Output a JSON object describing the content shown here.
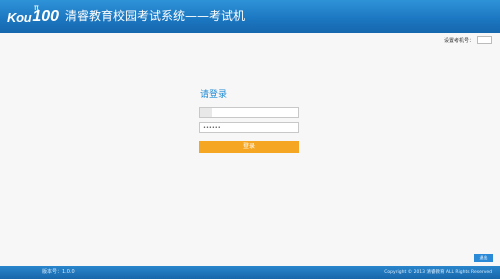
{
  "header": {
    "logo_text": "Kou",
    "logo_number": "100",
    "logo_mark": "π",
    "title": "清睿教育校园考试系统——考试机"
  },
  "machine": {
    "label": "设置考机号："
  },
  "login": {
    "title": "请登录",
    "username_value": "",
    "password_value": "••••••",
    "button_label": "登录"
  },
  "exit_button": "退出",
  "footer": {
    "version": "版本号：1.0.0",
    "copyright": "Copyright © 2013 清睿教育 ALL Rights Reserved"
  },
  "colors": {
    "header_blue": "#1c78c2",
    "accent_blue": "#1e8ad6",
    "button_orange": "#f5a623",
    "background": "#f7f7f7"
  }
}
